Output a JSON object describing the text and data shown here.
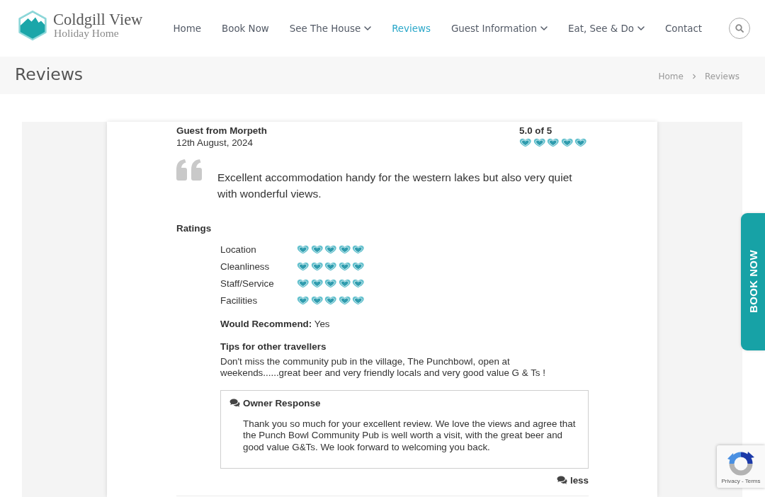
{
  "header": {
    "logo": {
      "name": "Coldgill View",
      "tagline": "Holiday Home"
    },
    "nav": [
      {
        "label": "Home",
        "selected": false,
        "has_submenu": false
      },
      {
        "label": "Book Now",
        "selected": false,
        "has_submenu": false
      },
      {
        "label": "See The House",
        "selected": false,
        "has_submenu": true
      },
      {
        "label": "Reviews",
        "selected": true,
        "has_submenu": false
      },
      {
        "label": "Guest Information",
        "selected": false,
        "has_submenu": true
      },
      {
        "label": "Eat, See & Do",
        "selected": false,
        "has_submenu": true
      },
      {
        "label": "Contact",
        "selected": false,
        "has_submenu": false
      }
    ]
  },
  "page_title": "Reviews",
  "breadcrumb": [
    "Home",
    "Reviews"
  ],
  "review": {
    "author": "Guest from Morpeth",
    "date": "12th August, 2024",
    "score": "5.0 of 5",
    "stars": 5,
    "text": "Excellent accommodation handy for the western lakes but also very quiet with wonderful views.",
    "ratings_heading": "Ratings",
    "ratings": [
      {
        "label": "Location",
        "stars": 5
      },
      {
        "label": "Cleanliness",
        "stars": 5
      },
      {
        "label": "Staff/Service",
        "stars": 5
      },
      {
        "label": "Facilities",
        "stars": 5
      }
    ],
    "recommendation": "**Would Recommend:** Yes",
    "tips": {
      "heading": "Tips for other travellers",
      "text": "Don't miss the community pub in the village, The Punchbowl, open at weekends......great beer and very friendly locals and very good value G & Ts !"
    },
    "owner_response": {
      "heading": "Owner Response",
      "text": "Thank you so much for your excellent review. We love the views and agree that the Punch Bowl Community Pub is well worth a visit, with the great beer and good value G&Ts. We look forward to welcoming you back."
    },
    "toggle_link": "less"
  },
  "book_now_tab": "BOOK NOW",
  "captcha_badge": {
    "links": "Privacy - Terms"
  }
}
